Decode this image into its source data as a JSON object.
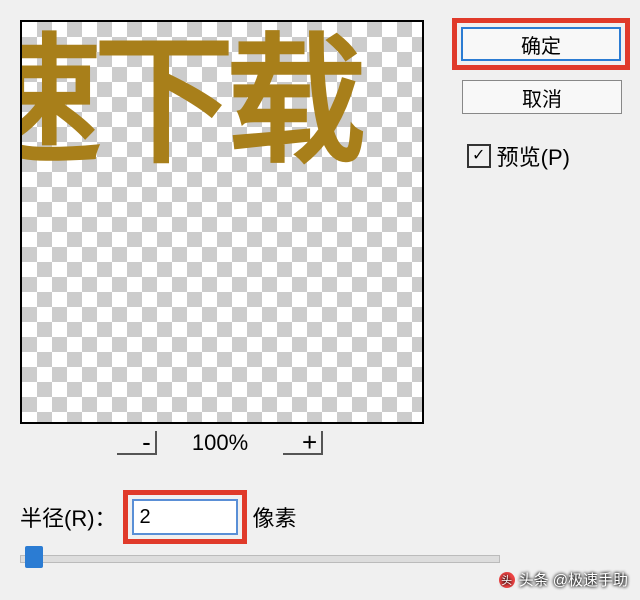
{
  "preview": {
    "sample_text": "速下载"
  },
  "zoom": {
    "out_label": "-",
    "in_label": "+",
    "value": "100%"
  },
  "radius": {
    "label": "半径(R)：",
    "value": "2",
    "unit": "像素"
  },
  "buttons": {
    "ok": "确定",
    "cancel": "取消"
  },
  "preview_checkbox": {
    "checked_glyph": "✓",
    "label": "预览(P)"
  },
  "watermark": {
    "icon": "头",
    "text": "头条 @极速手助"
  }
}
